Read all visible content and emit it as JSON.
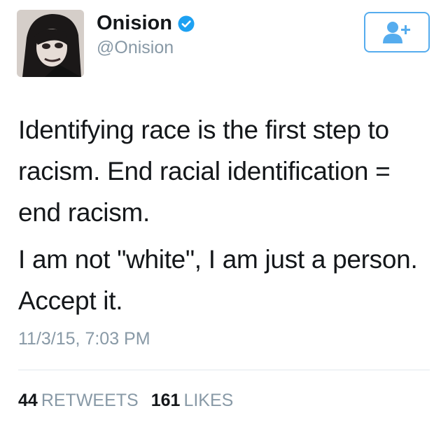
{
  "user": {
    "display_name": "Onision",
    "handle": "@Onision",
    "verified": true,
    "verified_color": "#1da1f2"
  },
  "follow_button": {
    "icon": "follow-user-icon",
    "color": "#55acee"
  },
  "tweet": {
    "paragraphs": [
      "Identifying race is the first step to racism. End racial identification = end racism.",
      "I am not \"white\", I am just a person. Accept it."
    ],
    "timestamp": "11/3/15, 7:03 PM"
  },
  "stats": {
    "retweets_count": "44",
    "retweets_label": "RETWEETS",
    "likes_count": "161",
    "likes_label": "LIKES"
  }
}
